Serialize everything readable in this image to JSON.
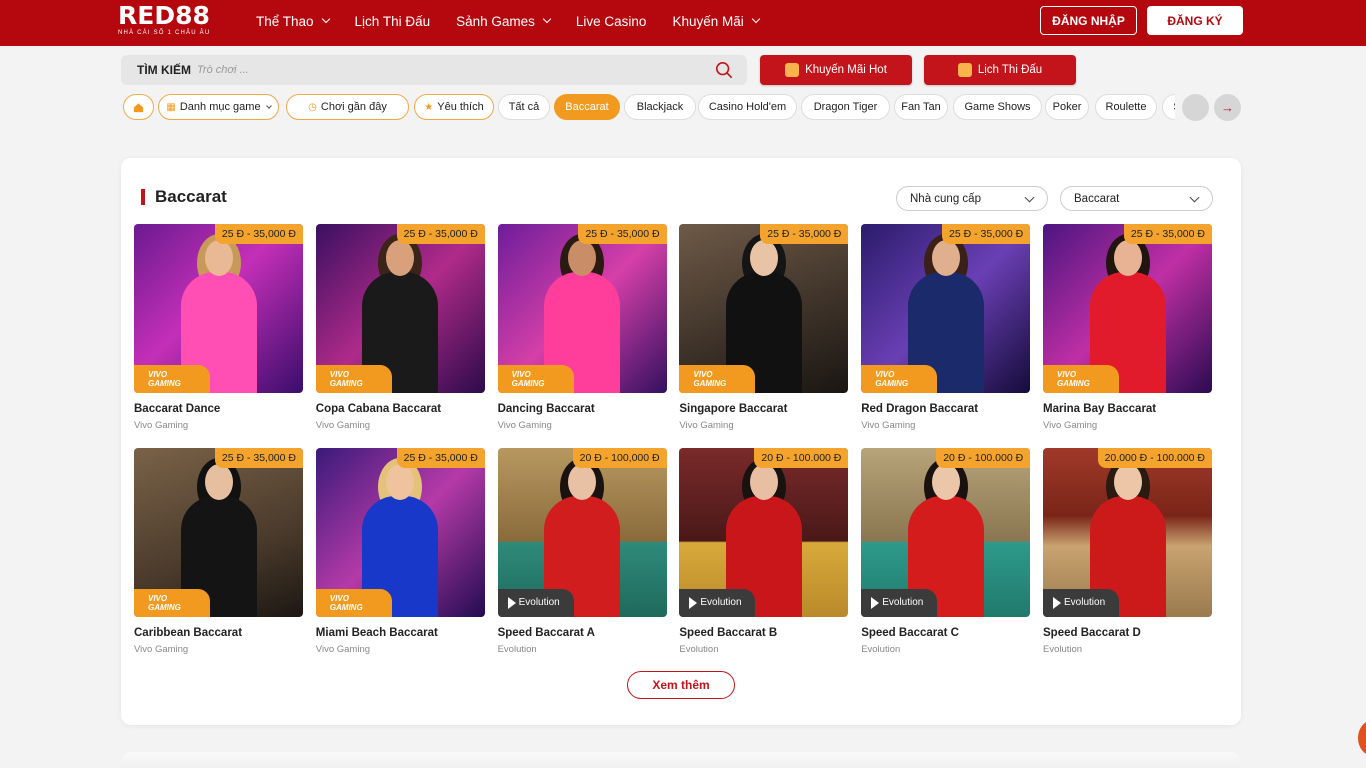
{
  "header": {
    "logo": "RED88",
    "logo_tagline": "NHÀ CÁI SỐ 1 CHÂU ÂU",
    "nav": [
      {
        "label": "Thể Thao",
        "has_dropdown": true
      },
      {
        "label": "Lịch Thi Đấu",
        "has_dropdown": false
      },
      {
        "label": "Sảnh Games",
        "has_dropdown": true
      },
      {
        "label": "Live Casino",
        "has_dropdown": false
      },
      {
        "label": "Khuyến Mãi",
        "has_dropdown": true
      }
    ],
    "login_label": "ĐĂNG NHẬP",
    "register_label": "ĐĂNG KÝ",
    "brand_color": "#b5070e"
  },
  "search": {
    "label": "TÌM KIẾM",
    "placeholder": "Trò chơi ..."
  },
  "promo_buttons": [
    {
      "label": "Khuyến Mãi Hot",
      "icon": "gift-icon"
    },
    {
      "label": "Lịch Thi Đấu",
      "icon": "calendar-icon"
    }
  ],
  "categories": {
    "home_icon": "home-icon",
    "menu": "Danh mục game",
    "recent": "Chơi gần đây",
    "favorites": "Yêu thích",
    "tabs": [
      "Tất cả",
      "Baccarat",
      "Blackjack",
      "Casino Hold'em",
      "Dragon Tiger",
      "Fan Tan",
      "Game Shows",
      "Poker",
      "Roulette",
      "S"
    ],
    "active": "Baccarat",
    "accent_color": "#f29a1f"
  },
  "section": {
    "title": "Baccarat",
    "provider_filter": "Nhà cung cấp",
    "type_filter": "Baccarat",
    "more_label": "Xem thêm"
  },
  "games": [
    {
      "name": "Baccarat Dance",
      "provider": "Vivo Gaming",
      "price": "25 Đ - 35,000 Đ",
      "badge": "VIVO GAMING"
    },
    {
      "name": "Copa Cabana Baccarat",
      "provider": "Vivo Gaming",
      "price": "25 Đ - 35,000 Đ",
      "badge": "VIVO GAMING"
    },
    {
      "name": "Dancing Baccarat",
      "provider": "Vivo Gaming",
      "price": "25 Đ - 35,000 Đ",
      "badge": "VIVO GAMING"
    },
    {
      "name": "Singapore Baccarat",
      "provider": "Vivo Gaming",
      "price": "25 Đ - 35,000 Đ",
      "badge": "VIVO GAMING"
    },
    {
      "name": "Red Dragon Baccarat",
      "provider": "Vivo Gaming",
      "price": "25 Đ - 35,000 Đ",
      "badge": "VIVO GAMING"
    },
    {
      "name": "Marina Bay Baccarat",
      "provider": "Vivo Gaming",
      "price": "25 Đ - 35,000 Đ",
      "badge": "VIVO GAMING"
    },
    {
      "name": "Caribbean Baccarat",
      "provider": "Vivo Gaming",
      "price": "25 Đ - 35,000 Đ",
      "badge": "VIVO GAMING"
    },
    {
      "name": "Miami Beach Baccarat",
      "provider": "Vivo Gaming",
      "price": "25 Đ - 35,000 Đ",
      "badge": "VIVO GAMING"
    },
    {
      "name": "Speed Baccarat A",
      "provider": "Evolution",
      "price": "20 Đ - 100,000 Đ",
      "badge": "Evolution"
    },
    {
      "name": "Speed Baccarat B",
      "provider": "Evolution",
      "price": "20 Đ - 100.000 Đ",
      "badge": "Evolution"
    },
    {
      "name": "Speed Baccarat C",
      "provider": "Evolution",
      "price": "20 Đ - 100.000 Đ",
      "badge": "Evolution"
    },
    {
      "name": "Speed Baccarat D",
      "provider": "Evolution",
      "price": "20.000 Đ - 100.000 Đ",
      "badge": "Evolution"
    }
  ]
}
